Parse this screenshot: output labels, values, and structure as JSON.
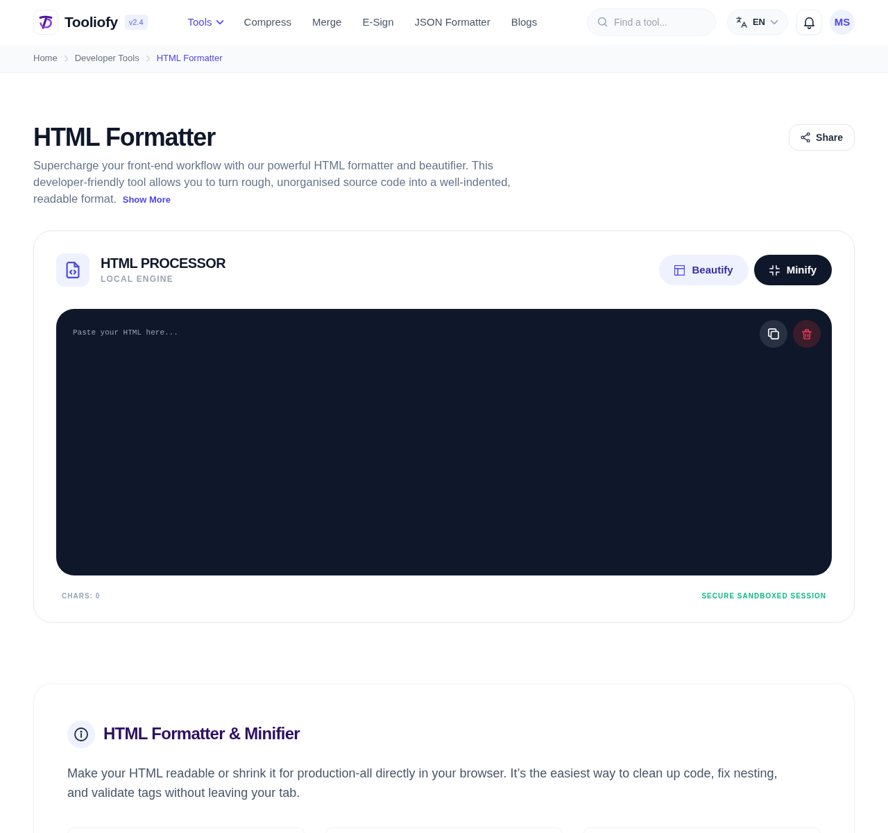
{
  "navbar": {
    "brand": "Tooliofy",
    "version": "v2.4",
    "links": [
      {
        "label": "Tools",
        "kind": "dropdown",
        "selected": true
      },
      {
        "label": "Compress",
        "kind": "link",
        "selected": false
      },
      {
        "label": "Merge",
        "kind": "link",
        "selected": false
      },
      {
        "label": "E-Sign",
        "kind": "link",
        "selected": false
      },
      {
        "label": "JSON Formatter",
        "kind": "link",
        "selected": false
      },
      {
        "label": "Blogs",
        "kind": "link",
        "selected": false
      }
    ],
    "search": {
      "placeholder": "Find a tool..."
    },
    "language": "EN",
    "avatar": "MS"
  },
  "breadcrumb": [
    {
      "label": "Home",
      "selected": false
    },
    {
      "label": "Developer Tools",
      "selected": false
    },
    {
      "label": "HTML Formatter",
      "selected": true
    }
  ],
  "header": {
    "title": "HTML Formatter",
    "description": "Supercharge your front-end workflow with our powerful HTML formatter and beautifier. This developer-friendly tool allows you to turn rough, unorganised source code into a well-indented, readable format.",
    "show_more": "Show More",
    "share_button": "Share"
  },
  "processor": {
    "title": "HTML PROCESSOR",
    "subtitle": "LOCAL ENGINE",
    "actions": [
      {
        "label": "Beautify",
        "kind": "soft"
      },
      {
        "label": "Minify",
        "kind": "solid"
      }
    ],
    "editor": {
      "placeholder": "Paste your HTML here..."
    },
    "char_count": "CHARS: 0",
    "session_status": "SECURE SANDBOXED SESSION"
  },
  "about": {
    "title": "HTML Formatter & Minifier",
    "text": "Make your HTML readable or shrink it for production-all directly in your browser. It’s the easiest way to clean up code, fix nesting, and validate tags without leaving your tab."
  }
}
